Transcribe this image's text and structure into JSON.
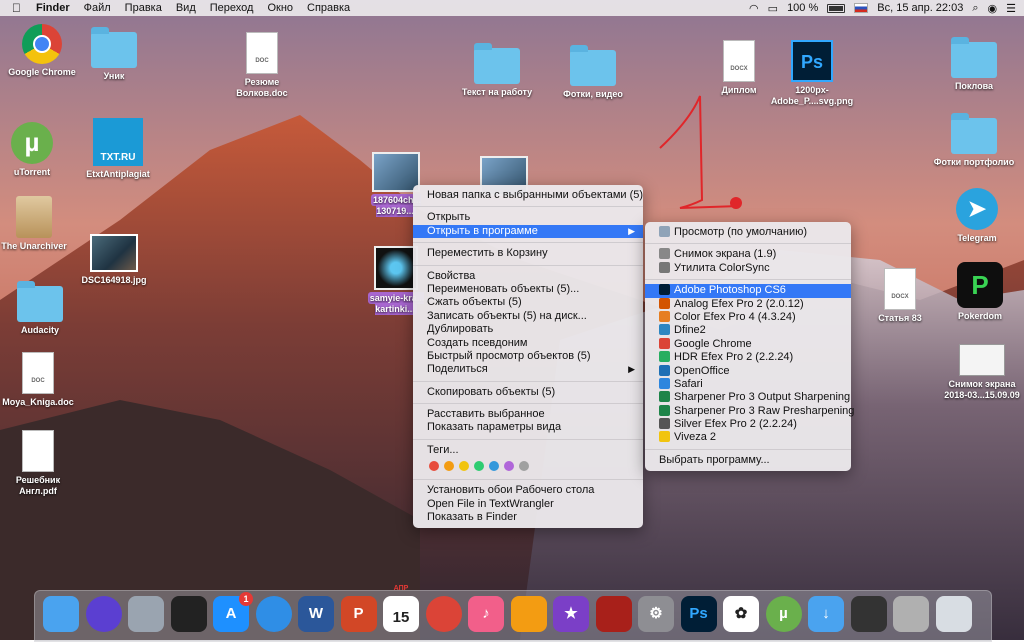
{
  "menubar": {
    "apple": "",
    "app": "Finder",
    "items": [
      "Файл",
      "Правка",
      "Вид",
      "Переход",
      "Окно",
      "Справка"
    ],
    "battery": "100 %",
    "datetime": "Вс, 15 апр.  22:03"
  },
  "desktop_icons": {
    "chrome": "Google Chrome",
    "unik": "Уник",
    "resume": "Резюме Волков.doc",
    "resume_tag": "DOC",
    "tekst": "Текст на работу",
    "fotki": "Фотки, видео",
    "diplom": "Диплом",
    "diplom_tag": "DOCX",
    "ps_file": "1200px-Adobe_P....svg.png",
    "poklova": "Поклова",
    "utorrent": "uTorrent",
    "etxt": "EtxtAntiplagiat",
    "txtru": "TXT.RU",
    "portfolio": "Фотки портфолио",
    "unarchiver": "The Unarchiver",
    "dsc": "DSC16491⁠8.jpg",
    "telegram": "Telegram",
    "audacity": "Audacity",
    "statya": "Статья 83",
    "statya_tag": "DOCX",
    "pokerdom": "Pokerdom",
    "screenshot": "Снимок экрана 2018-03...15.09.09",
    "moya": "Moya_Kniga.doc",
    "moya_tag": "DOC",
    "reshebnik": "Решебник Англ.pdf",
    "sel1": "187604ch... 130719...",
    "sel2": "samyie-kra... kartinki..."
  },
  "context_menu": {
    "new_folder": "Новая папка с выбранными объектами (5)",
    "open": "Открыть",
    "open_with": "Открыть в программе",
    "trash": "Переместить в Корзину",
    "info": "Свойства",
    "rename": "Переименовать объекты (5)...",
    "compress": "Сжать объекты (5)",
    "burn": "Записать объекты (5) на диск...",
    "duplicate": "Дублировать",
    "alias": "Создать псевдоним",
    "quicklook": "Быстрый просмотр объектов (5)",
    "share": "Поделиться",
    "copy": "Скопировать объекты (5)",
    "arrange": "Расставить выбранное",
    "view_options": "Показать параметры вида",
    "tags": "Теги...",
    "tag_colors": [
      "#e74c3c",
      "#f39c12",
      "#f1c40f",
      "#2ecc71",
      "#3498db",
      "#b066d9",
      "#a0a0a0"
    ],
    "wallpaper": "Установить обои Рабочего стола",
    "textwrangler": "Open File in TextWrangler",
    "show_finder": "Показать в Finder"
  },
  "submenu": {
    "items": [
      {
        "label": "Просмотр (по умолчанию)",
        "color": "#8fa3b8"
      },
      {
        "label": "Снимок экрана (1.9)",
        "color": "#888"
      },
      {
        "label": "Утилита ColorSync",
        "color": "#777"
      },
      {
        "label": "Adobe Photoshop CS6",
        "color": "#001e36"
      },
      {
        "label": "Analog Efex Pro 2 (2.0.12)",
        "color": "#d35400"
      },
      {
        "label": "Color Efex Pro 4 (4.3.24)",
        "color": "#e67e22"
      },
      {
        "label": "Dfine2",
        "color": "#2e86c1"
      },
      {
        "label": "Google Chrome",
        "color": "#db4437"
      },
      {
        "label": "HDR Efex Pro 2 (2.2.24)",
        "color": "#27ae60"
      },
      {
        "label": "OpenOffice",
        "color": "#1f6fb5"
      },
      {
        "label": "Safari",
        "color": "#2e86de"
      },
      {
        "label": "Sharpener Pro 3 Output Sharpening",
        "color": "#1e8449"
      },
      {
        "label": "Sharpener Pro 3 Raw Presharpening",
        "color": "#1e8449"
      },
      {
        "label": "Silver Efex Pro 2 (2.2.24)",
        "color": "#555"
      },
      {
        "label": "Viveza 2",
        "color": "#f1c40f"
      }
    ],
    "choose": "Выбрать программу..."
  },
  "dock": {
    "items": [
      {
        "name": "finder",
        "bg": "#4aa3ef",
        "txt": ""
      },
      {
        "name": "siri",
        "bg": "#5b3fd1",
        "txt": ""
      },
      {
        "name": "launchpad",
        "bg": "#9aa4b0",
        "txt": ""
      },
      {
        "name": "activity",
        "bg": "#222",
        "txt": ""
      },
      {
        "name": "appstore",
        "bg": "#1e90ff",
        "txt": "A"
      },
      {
        "name": "safari",
        "bg": "#2f8ee6",
        "txt": ""
      },
      {
        "name": "word",
        "bg": "#2b579a",
        "txt": "W"
      },
      {
        "name": "powerpoint",
        "bg": "#d24726",
        "txt": "P"
      },
      {
        "name": "calendar",
        "bg": "#ffffff",
        "txt": "15"
      },
      {
        "name": "chrome",
        "bg": "#db4437",
        "txt": ""
      },
      {
        "name": "itunes",
        "bg": "#f25f8a",
        "txt": "♪"
      },
      {
        "name": "ibooks",
        "bg": "#f39c12",
        "txt": ""
      },
      {
        "name": "imovie",
        "bg": "#7b3fc7",
        "txt": "★"
      },
      {
        "name": "photobooth",
        "bg": "#a8201a",
        "txt": ""
      },
      {
        "name": "preferences",
        "bg": "#8e8e93",
        "txt": "⚙"
      },
      {
        "name": "photoshop",
        "bg": "#001e36",
        "txt": "Ps"
      },
      {
        "name": "photos",
        "bg": "#ffffff",
        "txt": "✿"
      },
      {
        "name": "utorrent",
        "bg": "#6ab04c",
        "txt": "µ"
      },
      {
        "name": "downloads",
        "bg": "#4aa3ef",
        "txt": "↓"
      },
      {
        "name": "screen",
        "bg": "#333",
        "txt": ""
      },
      {
        "name": "pics",
        "bg": "#b0b0b0",
        "txt": ""
      },
      {
        "name": "trash",
        "bg": "#d8dde3",
        "txt": ""
      }
    ],
    "appstore_badge": "1",
    "calendar_month": "АПР"
  }
}
